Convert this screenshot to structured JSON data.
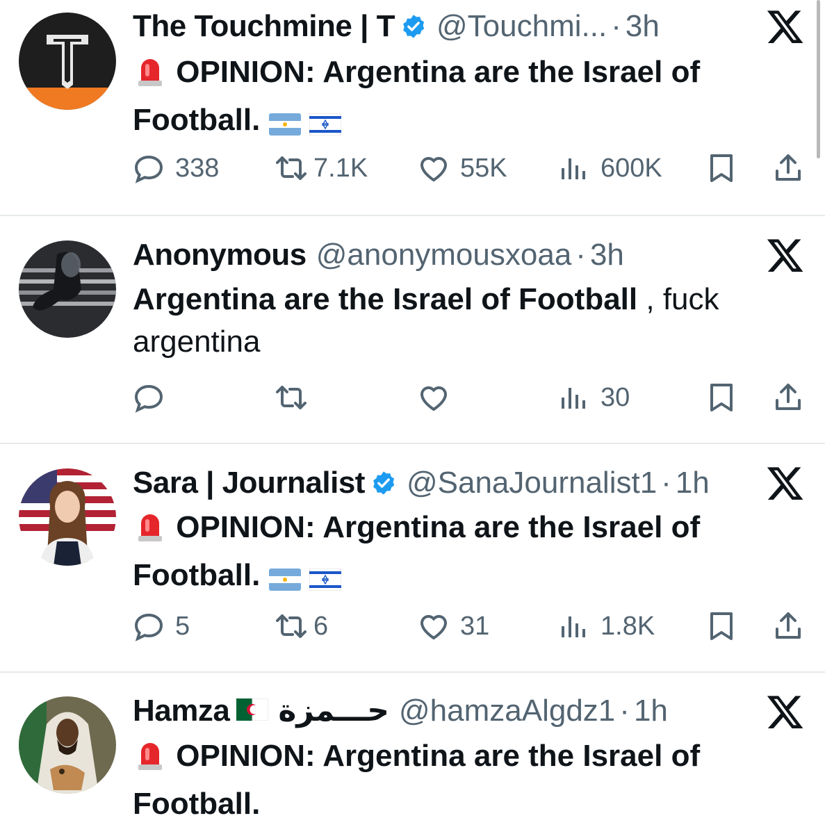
{
  "posts": [
    {
      "name": "The Touchmine | T",
      "handle": "@Touchmi...",
      "time": "3h",
      "verified": true,
      "text_bold": "OPINION: Argentina are the Israel of Football.",
      "text_rest": "",
      "has_alert_emoji": true,
      "flags": [
        "argentina-flag",
        "israel-flag"
      ],
      "replies": "338",
      "reposts": "7.1K",
      "likes": "55K",
      "views": "600K"
    },
    {
      "name": "Anonymous",
      "handle": "@anonymousxoaa",
      "time": "3h",
      "verified": false,
      "text_bold": "Argentina are the Israel of Football",
      "text_rest": " , fuck argentina",
      "has_alert_emoji": false,
      "flags": [],
      "replies": "",
      "reposts": "",
      "likes": "",
      "views": "30"
    },
    {
      "name": "Sara | Journalist",
      "handle": "@SanaJournalist1",
      "time": "1h",
      "verified": true,
      "text_bold": "OPINION: Argentina are the Israel of Football.",
      "text_rest": "",
      "has_alert_emoji": true,
      "flags": [
        "argentina-flag",
        "israel-flag"
      ],
      "replies": "5",
      "reposts": "6",
      "likes": "31",
      "views": "1.8K"
    },
    {
      "name": "Hamza",
      "name_suffix": "حـــمزة",
      "handle": "@hamzaAlgdz1",
      "time": "1h",
      "verified": false,
      "text_bold": "OPINION: Argentina are the Israel of Football.",
      "text_rest": "",
      "has_alert_emoji": true,
      "flags": []
    }
  ],
  "separator": "·",
  "colors": {
    "text": "#0f1419",
    "secondary": "#536471",
    "verified": "#1d9bf0",
    "divider": "#e6e9eb"
  }
}
